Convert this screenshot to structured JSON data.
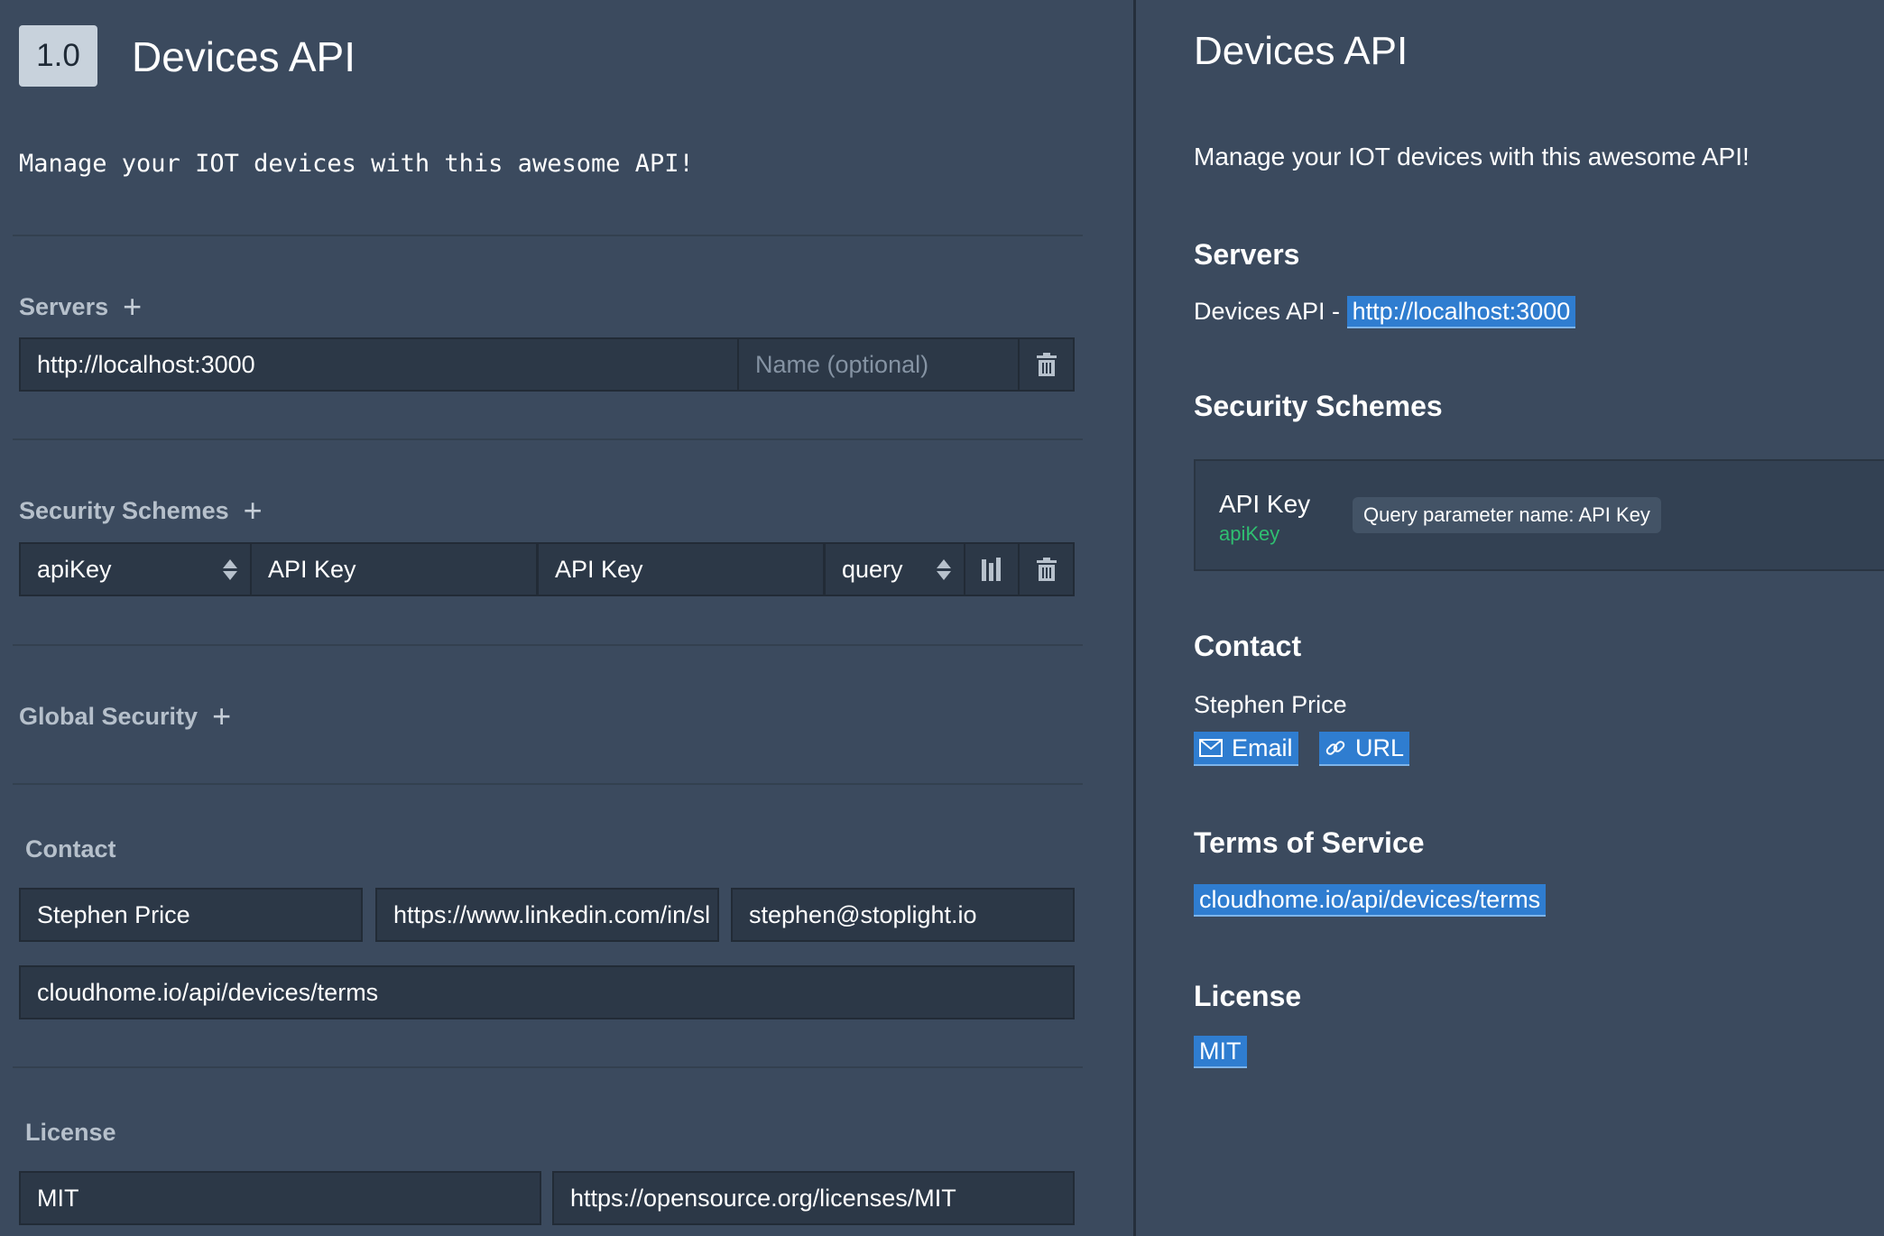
{
  "editor": {
    "version": "1.0",
    "title": "Devices API",
    "description": "Manage your IOT devices with this awesome API!",
    "servers": {
      "label": "Servers",
      "url_value": "http://localhost:3000",
      "name_placeholder": "Name (optional)"
    },
    "security_schemes": {
      "label": "Security Schemes",
      "type_value": "apiKey",
      "name_value": "API Key",
      "key_value": "API Key",
      "in_value": "query"
    },
    "global_security": {
      "label": "Global Security"
    },
    "contact": {
      "label": "Contact",
      "name_value": "Stephen Price",
      "url_value": "https://www.linkedin.com/in/sl",
      "email_value": "stephen@stoplight.io",
      "terms_value": "cloudhome.io/api/devices/terms"
    },
    "license": {
      "label": "License",
      "name_value": "MIT",
      "url_value": "https://opensource.org/licenses/MIT"
    }
  },
  "preview": {
    "title": "Devices API",
    "description": "Manage your IOT devices with this awesome API!",
    "servers_heading": "Servers",
    "server_name": "Devices API -",
    "server_url": "http://localhost:3000",
    "security_heading": "Security Schemes",
    "scheme_name": "API Key",
    "scheme_type": "apiKey",
    "scheme_chip": "Query parameter name: API Key",
    "contact_heading": "Contact",
    "contact_name": "Stephen Price",
    "email_label": "Email",
    "url_label": "URL",
    "tos_heading": "Terms of Service",
    "tos_link": "cloudhome.io/api/devices/terms",
    "license_heading": "License",
    "license_link": "MIT"
  },
  "colors": {
    "background": "#3b4a5e",
    "input": "#2c3847",
    "link_highlight": "#2f7dd0",
    "scheme_type_green": "#2fbf71"
  },
  "icons": [
    "plus-icon",
    "trash-icon",
    "sort-arrows-icon",
    "columns-icon",
    "envelope-icon",
    "link-icon"
  ]
}
